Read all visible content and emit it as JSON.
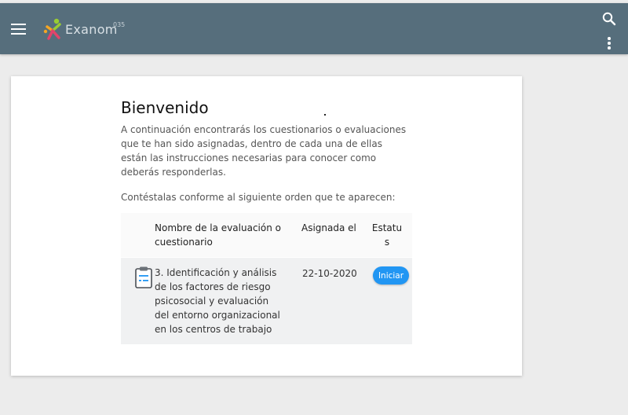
{
  "app": {
    "logo_text": "Exanom",
    "logo_sup": "035"
  },
  "topbar": {
    "menu_icon": "hamburger-menu-icon",
    "search_icon": "search-icon",
    "more_icon": "more-vert-icon",
    "color": "#566e7c"
  },
  "main": {
    "title": "Bienvenido",
    "intro": "A continuación encontrarás los cuestionarios o evaluaciones que te han sido asignadas, dentro de cada una de ellas están las instrucciones necesarias para conocer como deberás responderlas.",
    "order_note": "Contéstalas conforme al siguiente orden que te aparecen:"
  },
  "table": {
    "headers": {
      "name": "Nombre de la evaluación o cuestionario",
      "assigned": "Asignada el",
      "status": "Estatus"
    },
    "rows": [
      {
        "icon": "clipboard-icon",
        "name": "3. Identificación y análisis de los factores de riesgo psicosocial y evaluación del entorno organizacional en los centros de trabajo",
        "assigned": "22-10-2020",
        "action_label": "Iniciar"
      }
    ]
  },
  "colors": {
    "accent": "#2196f3",
    "background": "#ececec"
  }
}
